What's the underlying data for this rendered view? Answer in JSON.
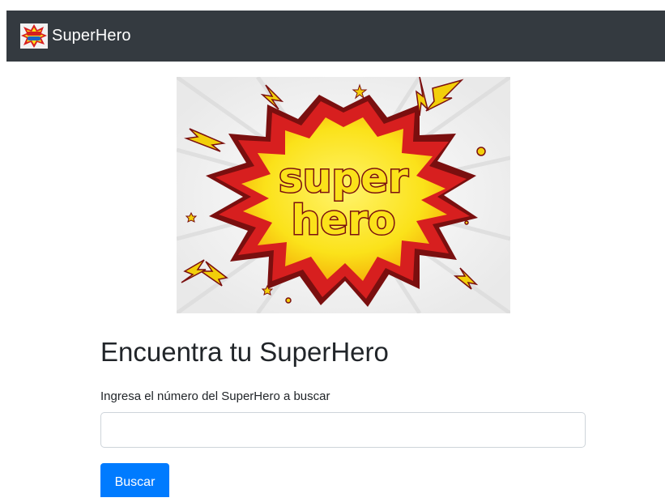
{
  "navbar": {
    "brand_text": "SuperHero",
    "brand_icon": "superhero-logo-icon",
    "background": "#343a40"
  },
  "hero": {
    "image_text_top": "super",
    "image_text_bottom": "hero",
    "colors": {
      "burst_yellow": "#fbe21a",
      "burst_red": "#d71f1f",
      "dark_red": "#7a0f0f",
      "ray_gray": "#e6e6e6"
    }
  },
  "form": {
    "title": "Encuentra tu SuperHero",
    "label": "Ingresa el número del SuperHero a buscar",
    "input_value": "",
    "input_placeholder": "",
    "button_label": "Buscar",
    "button_color": "#007bff"
  }
}
